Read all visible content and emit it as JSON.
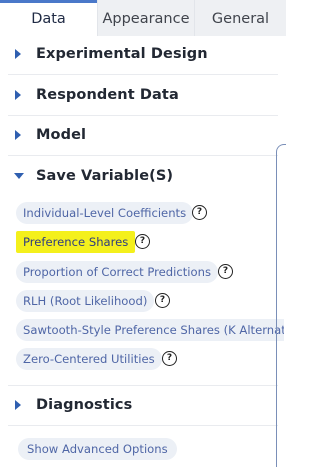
{
  "tabs": [
    {
      "label": "Data"
    },
    {
      "label": "Appearance"
    },
    {
      "label": "General"
    }
  ],
  "sections": {
    "experimental_design": "Experimental Design",
    "respondent_data": "Respondent Data",
    "model": "Model",
    "save_variables": "Save Variable(S)",
    "diagnostics": "Diagnostics"
  },
  "save_variables": {
    "items": [
      {
        "label": "Individual-Level Coefficients"
      },
      {
        "label": "Preference Shares"
      },
      {
        "label": "Proportion of Correct Predictions"
      },
      {
        "label": "RLH (Root Likelihood)"
      },
      {
        "label": "Sawtooth-Style Preference Shares (K Alternatives)"
      },
      {
        "label": "Zero-Centered Utilities"
      }
    ]
  },
  "help_glyph": "?",
  "show_advanced": "Show Advanced Options",
  "colors": {
    "accent": "#4a78c9",
    "chip_bg": "#ecf0f6",
    "chip_text": "#4f66a6",
    "highlight": "#f4f01c"
  }
}
